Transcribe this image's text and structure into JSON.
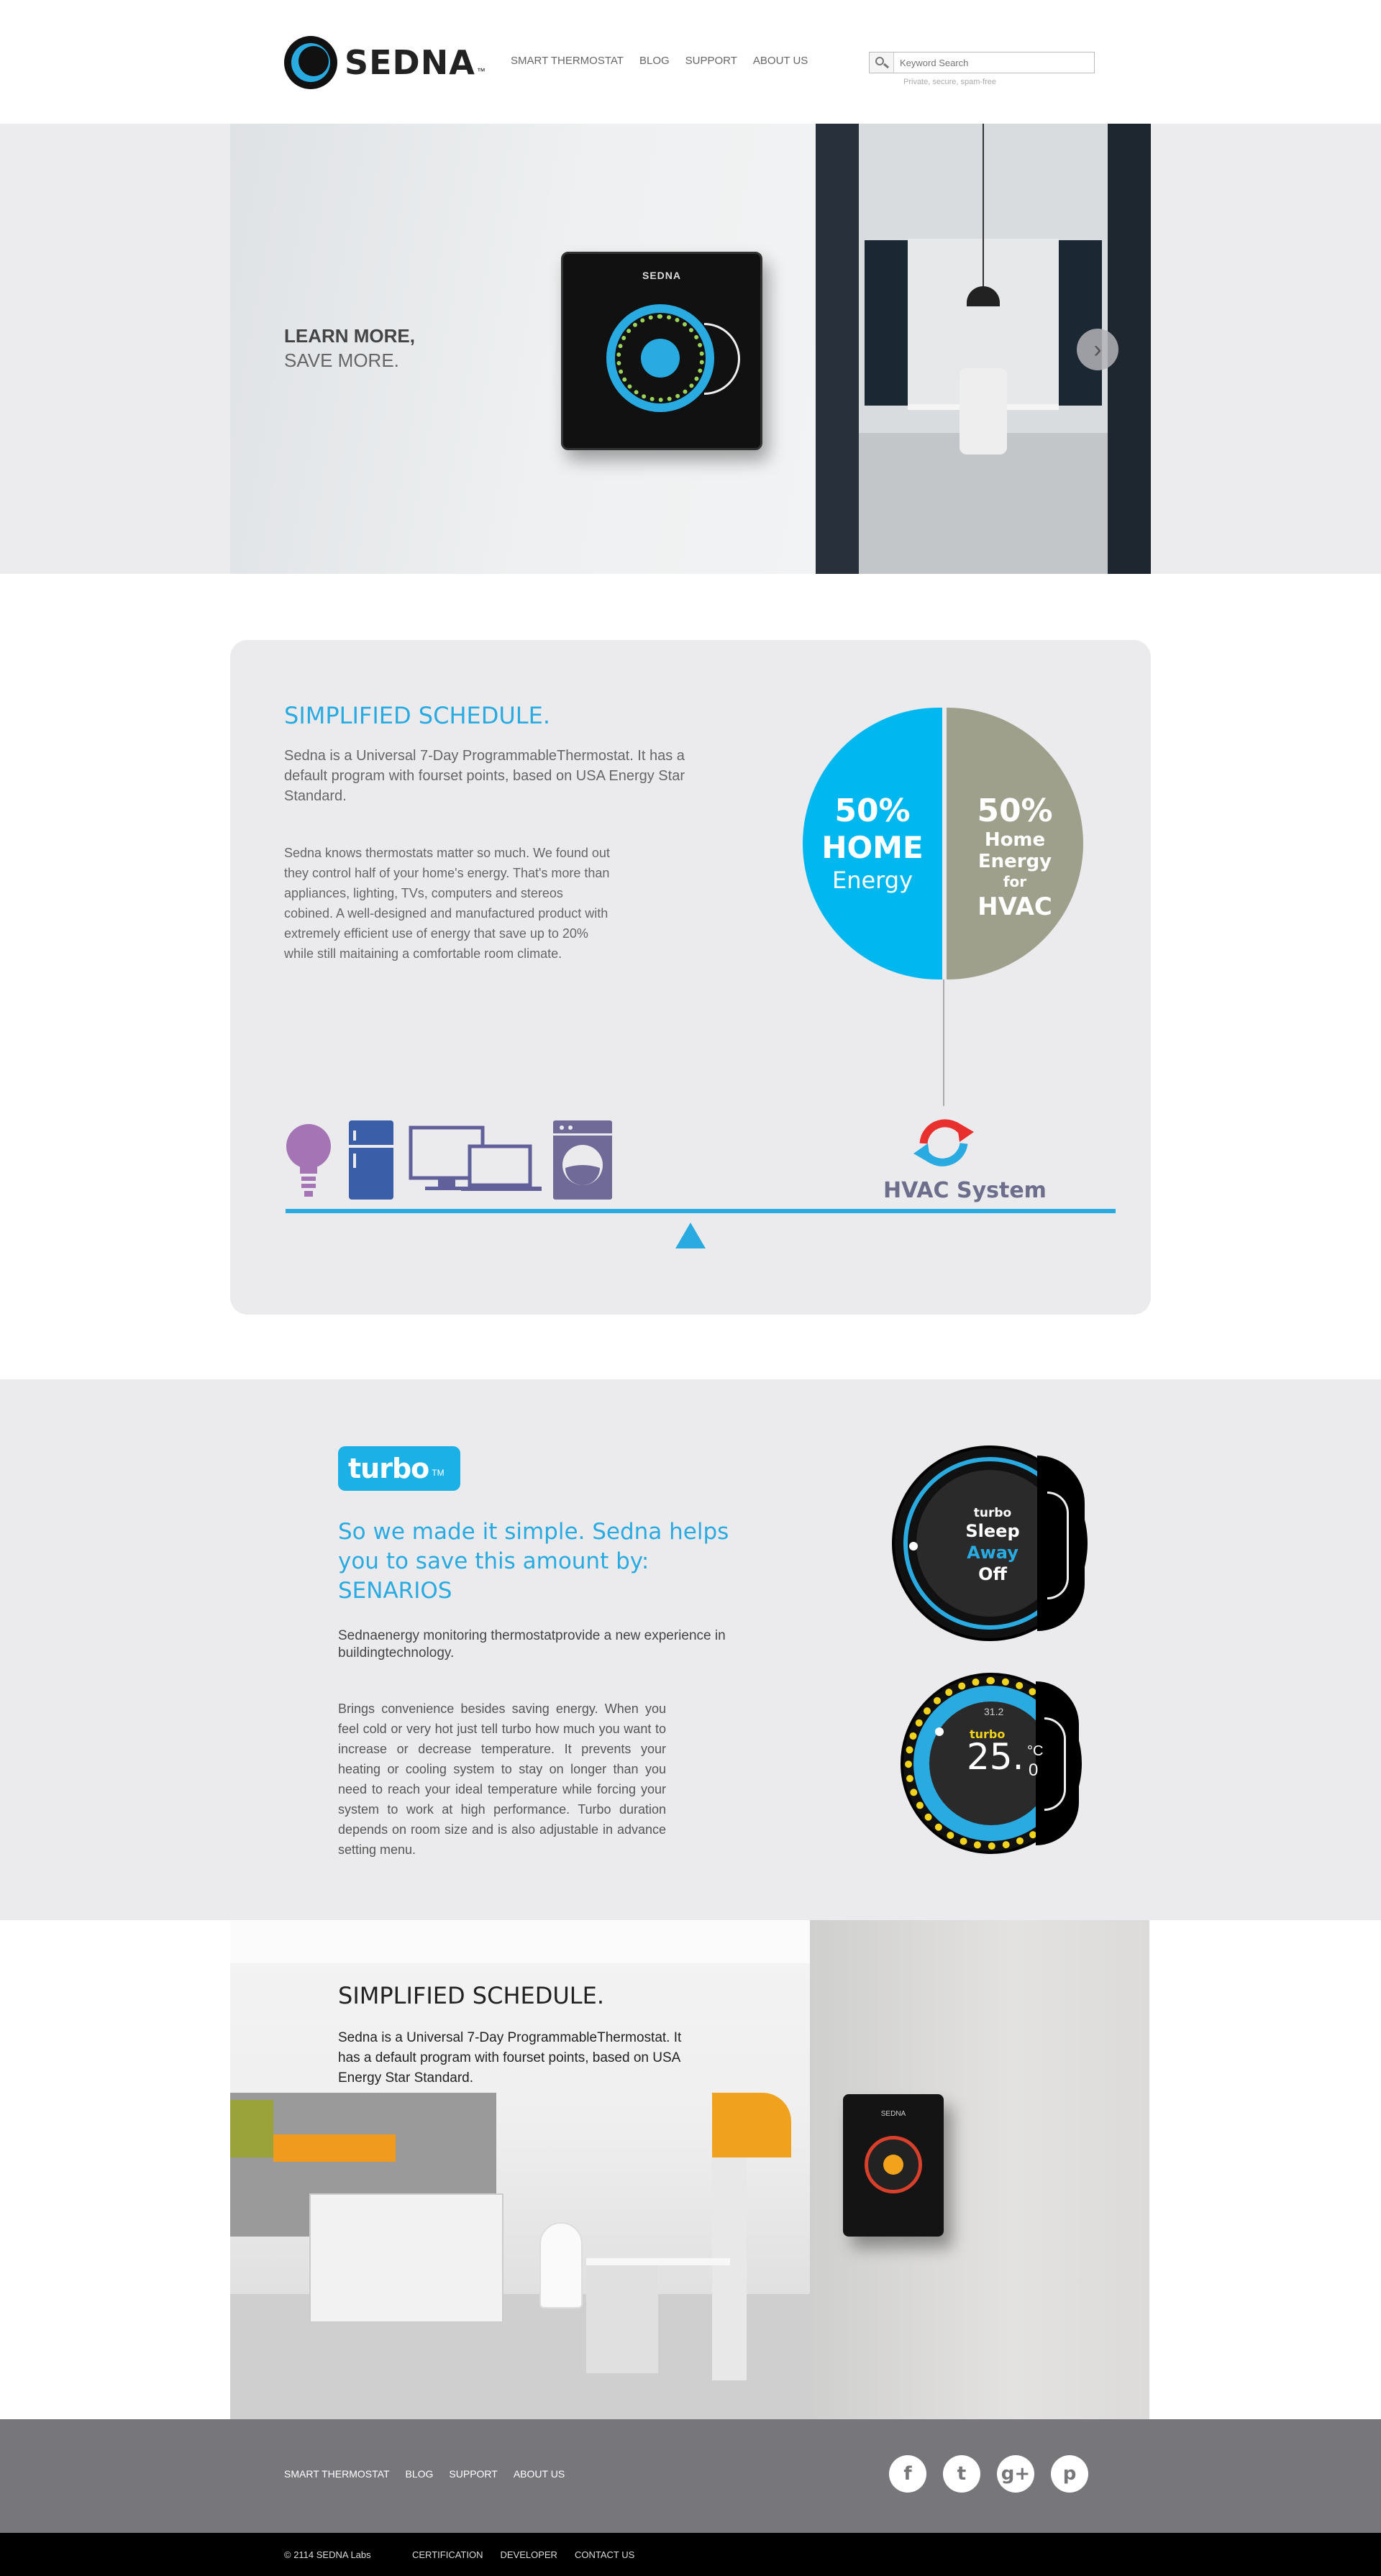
{
  "brand": {
    "name": "SEDNA",
    "tm": "™"
  },
  "nav": {
    "items": [
      "SMART THERMOSTAT",
      "BLOG",
      "SUPPORT",
      "ABOUT US"
    ]
  },
  "search": {
    "placeholder": "Keyword Search",
    "note": "Private, secure, spam-free"
  },
  "hero": {
    "title": "LEARN MORE,",
    "subtitle": "SAVE MORE.",
    "device_brand": "SEDNA",
    "next_arrow": "›"
  },
  "schedule": {
    "title": "SIMPLIFIED SCHEDULE.",
    "intro": "Sedna is a Universal 7-Day ProgrammableThermostat. It has a default program with fourset points, based on USA Energy Star Standard.",
    "body": "Sedna knows thermostats matter so much. We found out they control half of your home's energy. That's more than appliances, lighting, TVs, computers and stereos cobined. A well-designed and manufactured product with extremely efficient use of energy that save up to 20% while still maitaining a comfortable room climate.",
    "pie_home_pct": "50%",
    "pie_home_label": "HOME",
    "pie_home_sub": "Energy",
    "pie_hvac_pct": "50%",
    "pie_hvac_l1": "Home Energy",
    "pie_hvac_l2": "for",
    "pie_hvac_l3": "HVAC",
    "hvac_label": "HVAC System",
    "colors": {
      "home": "#00b7ef",
      "hvac": "#9fa08c",
      "accent": "#29abe2"
    },
    "appliance_icons": [
      "lightbulb-icon",
      "fridge-icon",
      "computers-icon",
      "washing-machine-icon"
    ]
  },
  "turbo": {
    "logo": "turbo",
    "logo_tm": "TM",
    "headline": "So we made it simple. Sedna helps you to save this amount by: SENARIOS",
    "intro": "Sednaenergy monitoring thermostatprovide a new experience in buildingtechnology.",
    "body": "Brings convenience besides saving energy. When you feel cold or very hot just tell turbo how much you want to increase or decrease temperature. It prevents your heating or cooling system to stay on longer than you need to reach your ideal temperature while forcing your system to work at high performance. Turbo duration depends on room size and is also adjustable in advance setting menu.",
    "dial1": {
      "brand": "turbo",
      "m1": "Sleep",
      "m2": "Away",
      "m3": "Off"
    },
    "dial2": {
      "small": "31.2",
      "brand": "turbo",
      "temp": "25.",
      "unit": "°C",
      "dec": "0"
    }
  },
  "office": {
    "title": "SIMPLIFIED SCHEDULE.",
    "text": "Sedna is a Universal 7-Day ProgrammableThermostat. It has a default program with fourset points, based on USA Energy Star Standard.",
    "device_brand": "SEDNA"
  },
  "footer": {
    "nav": [
      "SMART THERMOSTAT",
      "BLOG",
      "SUPPORT",
      "ABOUT US"
    ],
    "social": [
      {
        "name": "facebook-icon",
        "glyph": "f"
      },
      {
        "name": "twitter-icon",
        "glyph": "t"
      },
      {
        "name": "google-plus-icon",
        "glyph": "g+"
      },
      {
        "name": "pinterest-icon",
        "glyph": "p"
      }
    ],
    "copyright": "© 2114 SEDNA Labs",
    "bottom_nav": [
      "CERTIFICATION",
      "DEVELOPER",
      "CONTACT US"
    ]
  }
}
